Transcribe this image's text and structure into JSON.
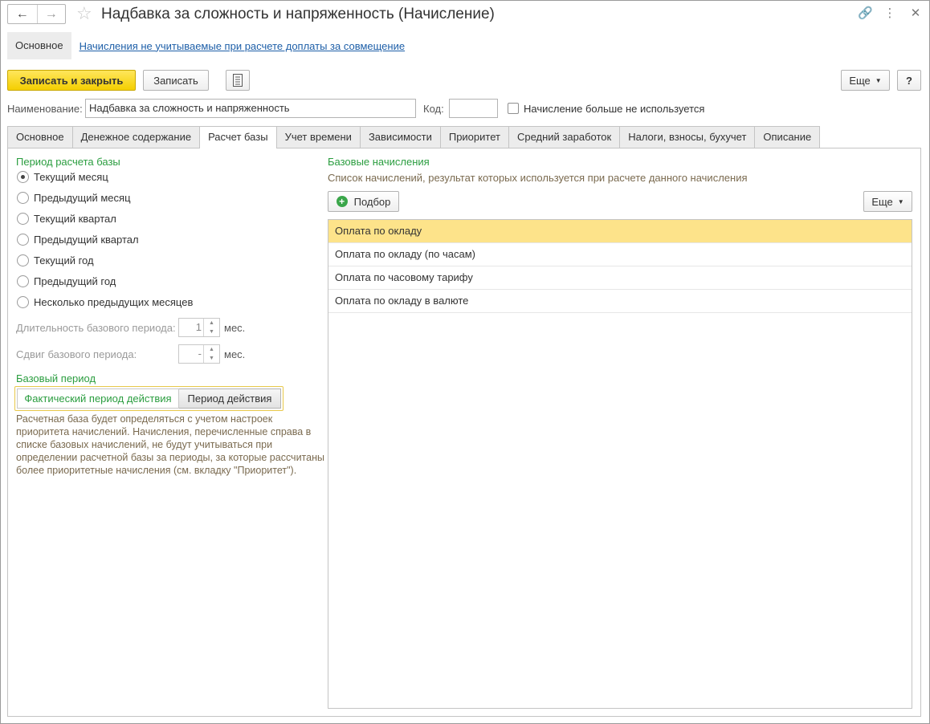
{
  "window": {
    "title": "Надбавка за сложность и напряженность (Начисление)",
    "icons": [
      "link-icon",
      "more-vertical-icon",
      "close-icon"
    ]
  },
  "section_nav": {
    "active": "Основное",
    "link": "Начисления не учитываемые при расчете доплаты за совмещение"
  },
  "toolbar": {
    "save_close": "Записать и закрыть",
    "save": "Записать",
    "more": "Еще",
    "help": "?"
  },
  "form": {
    "name_label": "Наименование:",
    "name_value": "Надбавка за сложность и напряженность",
    "code_label": "Код:",
    "code_value": "",
    "unused_label": "Начисление больше не используется",
    "unused_checked": false
  },
  "tabs": [
    {
      "label": "Основное"
    },
    {
      "label": "Денежное содержание"
    },
    {
      "label": "Расчет базы"
    },
    {
      "label": "Учет времени"
    },
    {
      "label": "Зависимости"
    },
    {
      "label": "Приоритет"
    },
    {
      "label": "Средний заработок"
    },
    {
      "label": "Налоги, взносы, бухучет"
    },
    {
      "label": "Описание"
    }
  ],
  "active_tab": "Расчет базы",
  "left": {
    "period_title": "Период расчета базы",
    "options": [
      {
        "label": "Текущий месяц",
        "selected": true
      },
      {
        "label": "Предыдущий месяц",
        "selected": false
      },
      {
        "label": "Текущий квартал",
        "selected": false
      },
      {
        "label": "Предыдущий квартал",
        "selected": false
      },
      {
        "label": "Текущий год",
        "selected": false
      },
      {
        "label": "Предыдущий год",
        "selected": false
      },
      {
        "label": "Несколько предыдущих месяцев",
        "selected": false
      }
    ],
    "duration_label": "Длительность базового периода:",
    "duration_value": "1",
    "duration_unit": "мес.",
    "shift_label": "Сдвиг базового периода:",
    "shift_value": "-",
    "shift_unit": "мес.",
    "base_period_title": "Базовый период",
    "toggle_a": "Фактический период действия",
    "toggle_b": "Период действия",
    "note": "Расчетная база будет определяться с учетом настроек приоритета начислений. Начисления, перечисленные справа в списке базовых начислений, не будут учитываться при определении расчетной базы за периоды, за которые рассчитаны более приоритетные начисления (см. вкладку \"Приоритет\")."
  },
  "right": {
    "title": "Базовые начисления",
    "subtitle": "Список начислений, результат которых используется при расчете данного начисления",
    "pick_button": "Подбор",
    "more": "Еще",
    "items": [
      "Оплата по окладу",
      "Оплата по окладу (по часам)",
      "Оплата по часовому тарифу",
      "Оплата по окладу в валюте"
    ],
    "selected_index": 0
  },
  "colors": {
    "accent_yellow": "#f4cf00",
    "green_heading": "#2a9d3f",
    "link_blue": "#1e5fa8",
    "selected_row": "#fde38a"
  }
}
